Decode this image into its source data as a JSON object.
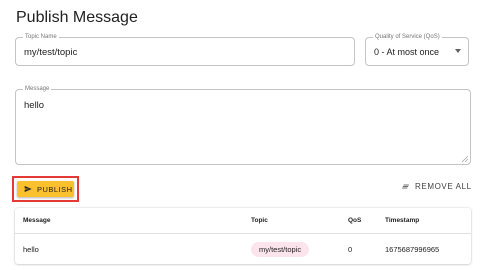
{
  "page": {
    "title": "Publish Message"
  },
  "form": {
    "topic": {
      "label": "Topic Name",
      "value": "my/test/topic"
    },
    "qos": {
      "label": "Quality of Service (QoS)",
      "selected": "0 - At most once"
    },
    "message": {
      "label": "Message",
      "value": "hello"
    }
  },
  "actions": {
    "publish_label": "PUBLISH",
    "remove_all_label": "REMOVE ALL"
  },
  "table": {
    "headers": [
      "Message",
      "Topic",
      "QoS",
      "Timestamp"
    ],
    "rows": [
      {
        "message": "hello",
        "topic": "my/test/topic",
        "qos": "0",
        "timestamp": "1675687996965"
      }
    ]
  },
  "colors": {
    "accent": "#fbc02d",
    "highlight_border": "#e53935",
    "topic_chip": "#fce4ec"
  },
  "icons": {
    "publish": "send-icon",
    "remove_all": "clear-all-icon",
    "qos_dropdown": "chevron-down-icon"
  }
}
